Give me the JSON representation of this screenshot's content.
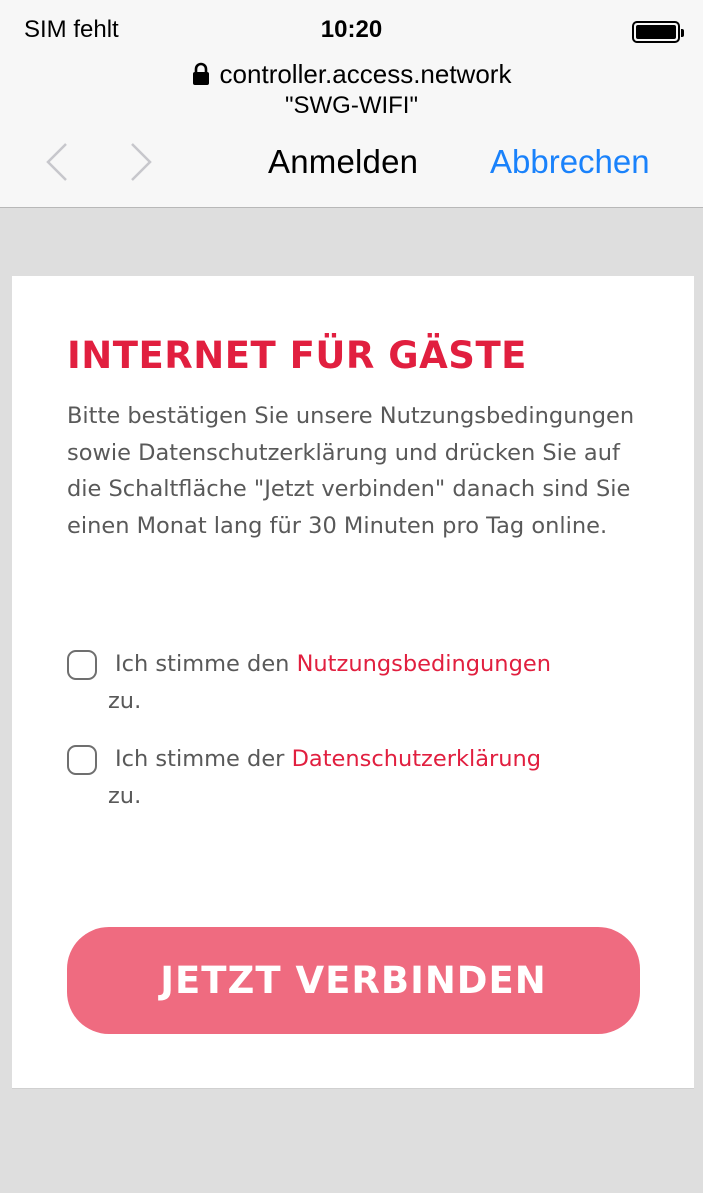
{
  "status_bar": {
    "carrier": "SIM fehlt",
    "time": "10:20",
    "battery_level": 1.0
  },
  "browser": {
    "url": "controller.access.network",
    "ssid": "\"SWG-WIFI\"",
    "title": "Anmelden",
    "cancel_label": "Abbrechen",
    "lock_icon": "lock-icon",
    "back_icon": "chevron-left-icon",
    "forward_icon": "chevron-right-icon"
  },
  "portal": {
    "title": "INTERNET FÜR GÄSTE",
    "intro": "Bitte bestätigen Sie unsere Nutzungsbedingungen sowie Datenschutzerklärung und drücken Sie auf die Schaltfläche \"Jetzt verbinden\" danach sind Sie einen Monat lang für 30 Minuten pro Tag online.",
    "consents": [
      {
        "prefix": "Ich stimme den ",
        "link": "Nutzungsbedingungen",
        "suffix": "zu.",
        "checked": false
      },
      {
        "prefix": "Ich stimme der ",
        "link": "Datenschutzerklärung",
        "suffix": "zu.",
        "checked": false
      }
    ],
    "connect_label": "JETZT VERBINDEN"
  },
  "colors": {
    "accent": "#e11f3f",
    "button": "#ef6b80",
    "ios_blue": "#1a82fb",
    "background": "#dedede"
  }
}
